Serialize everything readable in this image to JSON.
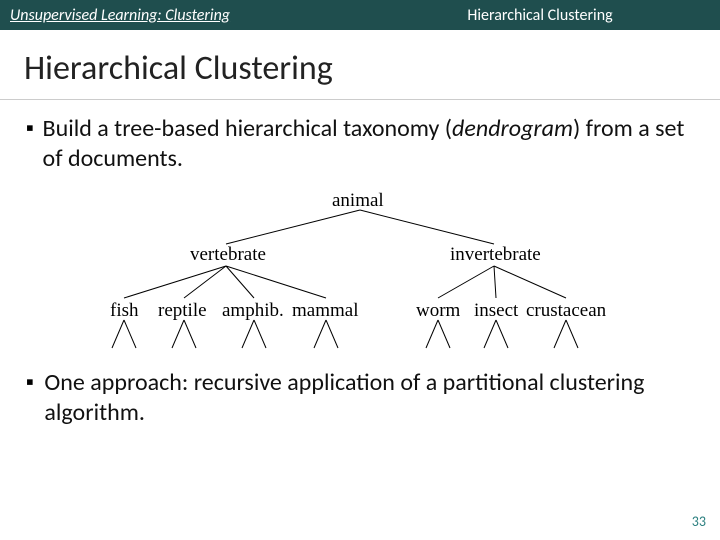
{
  "topbar": {
    "left": "Unsupervised Learning: Clustering",
    "right": "Hierarchical Clustering"
  },
  "title": "Hierarchical Clustering",
  "bullets": {
    "b1a": "Build a tree-based hierarchical taxonomy (",
    "b1b": "dendrogram",
    "b1c": ") from a set of documents.",
    "b2": "One approach: recursive application of a partitional clustering algorithm."
  },
  "tree": {
    "root": "animal",
    "L": "vertebrate",
    "R": "invertebrate",
    "LL": [
      "fish",
      "reptile",
      "amphib.",
      "mammal"
    ],
    "RR": [
      "worm",
      "insect",
      "crustacean"
    ]
  },
  "page": "33"
}
